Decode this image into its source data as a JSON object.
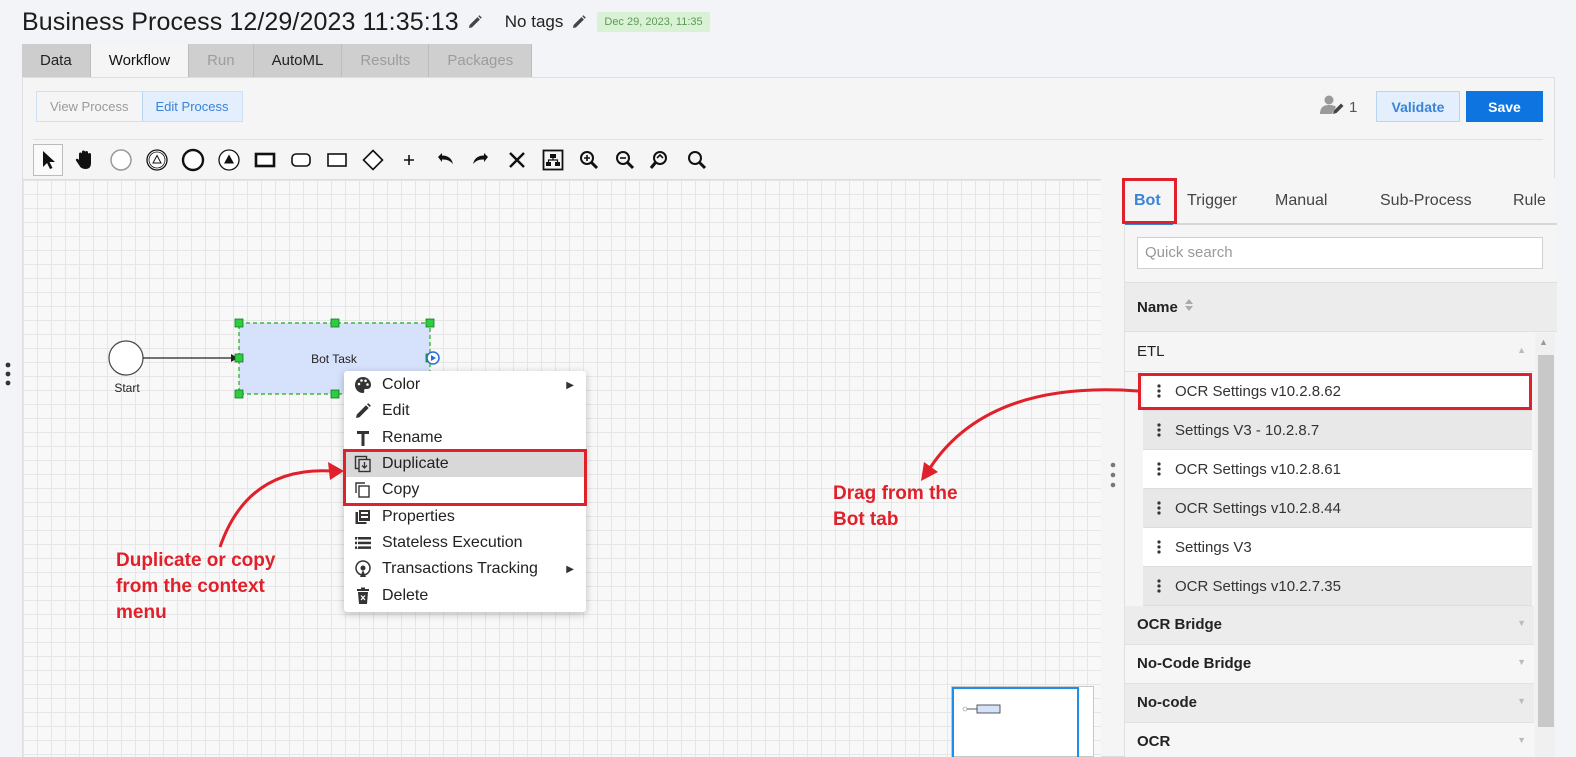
{
  "header": {
    "title": "Business Process 12/29/2023 11:35:13",
    "tags": "No tags",
    "date_badge": "Dec 29, 2023, 11:35"
  },
  "tabs": [
    {
      "label": "Data",
      "state": "normal"
    },
    {
      "label": "Workflow",
      "state": "active"
    },
    {
      "label": "Run",
      "state": "disabled"
    },
    {
      "label": "AutoML",
      "state": "normal"
    },
    {
      "label": "Results",
      "state": "disabled"
    },
    {
      "label": "Packages",
      "state": "disabled"
    }
  ],
  "mode": {
    "view_label": "View Process",
    "edit_label": "Edit Process",
    "active": "edit"
  },
  "actions": {
    "user_count": "1",
    "validate_label": "Validate",
    "save_label": "Save"
  },
  "toolbar": {
    "tools": [
      "pointer-tool-icon",
      "hand-tool-icon",
      "start-event-icon",
      "message-event-icon",
      "end-event-icon",
      "signal-event-icon",
      "task-icon",
      "subprocess-icon",
      "pool-icon",
      "gateway-icon",
      "add-icon",
      "undo-icon",
      "redo-icon",
      "delete-icon",
      "auto-layout-icon",
      "zoom-in-icon",
      "zoom-out-icon",
      "zoom-reset-icon",
      "zoom-fit-icon"
    ]
  },
  "diagram": {
    "start_label": "Start",
    "task_label": "Bot Task",
    "selection_color": "#22aa22",
    "task_fill": "#d6e2fb"
  },
  "context_menu": {
    "items": [
      {
        "label": "Color",
        "icon": "palette-icon",
        "submenu": true
      },
      {
        "label": "Edit",
        "icon": "pencil-icon",
        "submenu": false
      },
      {
        "label": "Rename",
        "icon": "text-icon",
        "submenu": false
      },
      {
        "label": "Duplicate",
        "icon": "duplicate-icon",
        "submenu": false,
        "highlighted": true
      },
      {
        "label": "Copy",
        "icon": "copy-icon",
        "submenu": false
      },
      {
        "label": "Properties",
        "icon": "properties-icon",
        "submenu": false
      },
      {
        "label": "Stateless Execution",
        "icon": "list-icon",
        "submenu": false
      },
      {
        "label": "Transactions Tracking",
        "icon": "tracking-icon",
        "submenu": true
      },
      {
        "label": "Delete",
        "icon": "trash-icon",
        "submenu": false
      }
    ]
  },
  "right_panel": {
    "tabs": [
      "Bot",
      "Trigger",
      "Manual",
      "Sub-Process",
      "Rule"
    ],
    "active_tab": "Bot",
    "search_placeholder": "Quick search",
    "name_header": "Name",
    "groups": [
      {
        "name": "ETL",
        "expanded": true,
        "items": [
          "OCR Settings v10.2.8.62",
          "Settings V3 - 10.2.8.7",
          "OCR Settings v10.2.8.61",
          "OCR Settings v10.2.8.44",
          "Settings V3",
          "OCR Settings v10.2.7.35"
        ]
      },
      {
        "name": "OCR Bridge",
        "expanded": false
      },
      {
        "name": "No-Code Bridge",
        "expanded": false
      },
      {
        "name": "No-code",
        "expanded": false
      },
      {
        "name": "OCR",
        "expanded": false
      }
    ]
  },
  "annotations": {
    "left_note": "Duplicate or copy from the context menu",
    "left_note_lines": [
      "Duplicate or copy",
      "from the context",
      "menu"
    ],
    "right_note_lines": [
      "Drag from the",
      "Bot tab"
    ],
    "color": "#e0202a"
  },
  "colors": {
    "accent": "#0d74e0",
    "accent_light": "#3a83d7",
    "annotation": "#e0202a"
  }
}
